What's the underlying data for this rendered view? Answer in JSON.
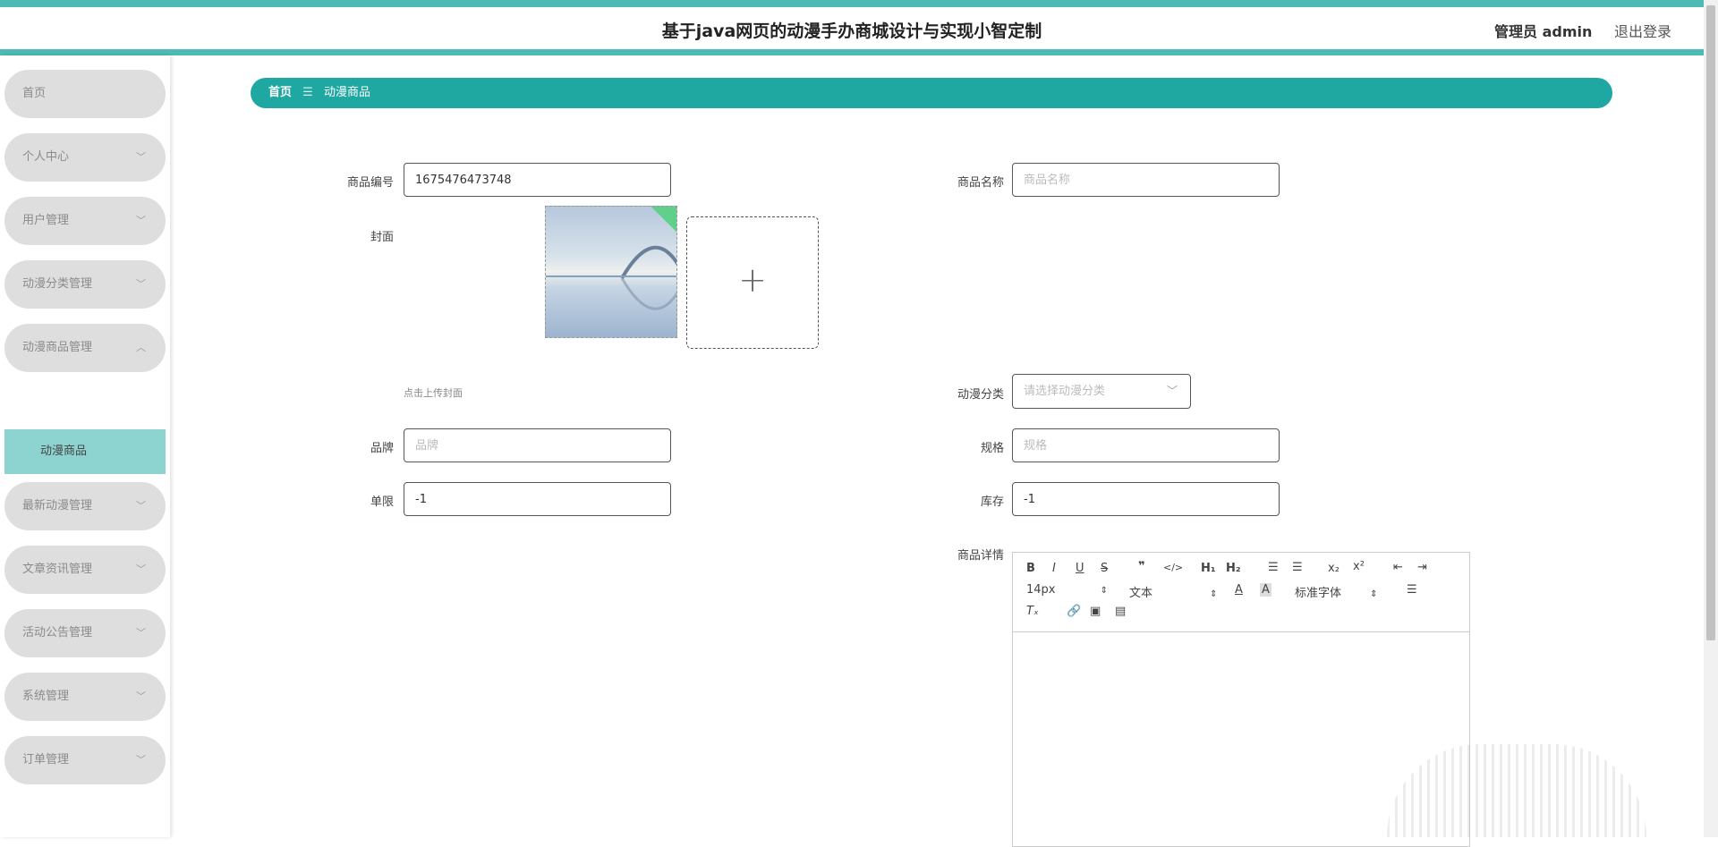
{
  "header": {
    "title": "基于java网页的动漫手办商城设计与实现小智定制",
    "user_label": "管理员 admin",
    "logout_label": "退出登录"
  },
  "sidebar": {
    "items": [
      {
        "label": "首页",
        "expanded": null
      },
      {
        "label": "个人中心",
        "expanded": false
      },
      {
        "label": "用户管理",
        "expanded": false
      },
      {
        "label": "动漫分类管理",
        "expanded": false
      },
      {
        "label": "动漫商品管理",
        "expanded": true
      },
      {
        "label": "最新动漫管理",
        "expanded": false
      },
      {
        "label": "文章资讯管理",
        "expanded": false
      },
      {
        "label": "活动公告管理",
        "expanded": false
      },
      {
        "label": "系统管理",
        "expanded": false
      },
      {
        "label": "订单管理",
        "expanded": false
      }
    ],
    "active_sub_item": "动漫商品"
  },
  "breadcrumb": {
    "home": "首页",
    "separator": "☰",
    "current": "动漫商品"
  },
  "form": {
    "product_no": {
      "label": "商品编号",
      "value": "1675476473748"
    },
    "product_name": {
      "label": "商品名称",
      "value": "",
      "placeholder": "商品名称"
    },
    "cover": {
      "label": "封面",
      "hint": "点击上传封面"
    },
    "category": {
      "label": "动漫分类",
      "placeholder": "请选择动漫分类"
    },
    "brand": {
      "label": "品牌",
      "value": "",
      "placeholder": "品牌"
    },
    "spec": {
      "label": "规格",
      "value": "",
      "placeholder": "规格"
    },
    "limit": {
      "label": "单限",
      "value": "-1"
    },
    "stock": {
      "label": "库存",
      "value": "-1"
    },
    "details": {
      "label": "商品详情",
      "font_size": "14px",
      "block_format": "文本",
      "font_family": "标准字体"
    }
  },
  "colors": {
    "accent": "#1fa7a2",
    "header_border": "#4dbab4",
    "submenu_active": "#8dd3cf",
    "menu_bg": "#dedede"
  }
}
